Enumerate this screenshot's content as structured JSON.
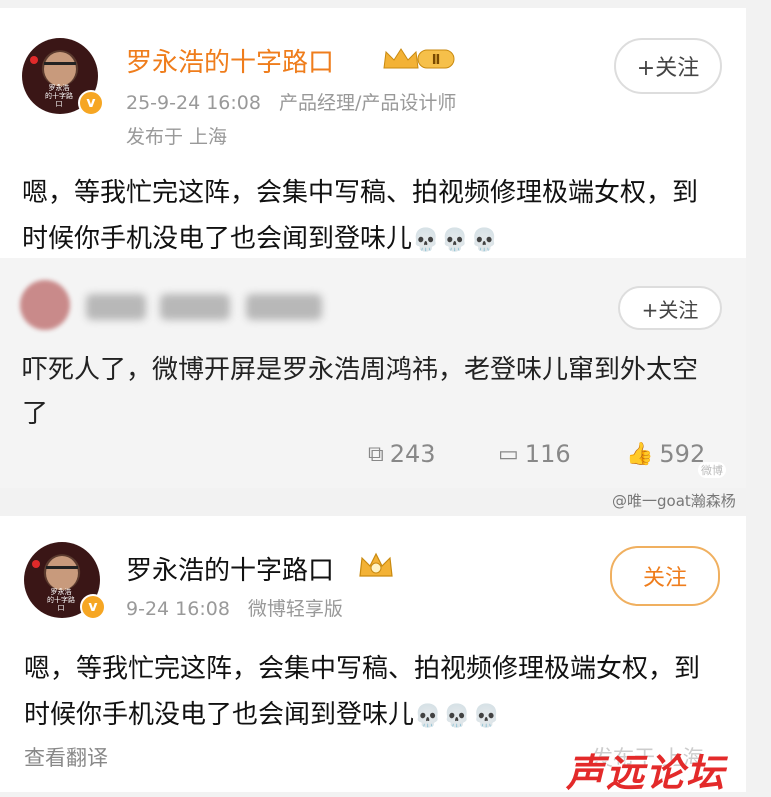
{
  "post1": {
    "username": "罗永浩的十字路口",
    "level_badge": "Ⅱ",
    "time": "25-9-24 16:08",
    "user_title": "产品经理/产品设计师",
    "location": "发布于 上海",
    "text": "嗯，等我忙完这阵，会集中写稿、拍视频修理极端女权，到时候你手机没电了也会闻到登味儿",
    "skulls": "💀💀💀",
    "follow_label": "+关注",
    "avatar_caption": "罗永浩 的十字路口"
  },
  "repost": {
    "text": "吓死人了，微博开屏是罗永浩周鸿祎，老登味儿窜到外太空了",
    "follow_label": "+关注",
    "reposts": "243",
    "comments": "116",
    "likes": "592"
  },
  "watermarks": {
    "author": "@唯一goat瀚森杨",
    "tiny": "微博"
  },
  "post2": {
    "username": "罗永浩的十字路口",
    "time": "9-24 16:08",
    "source": "微博轻享版",
    "text": "嗯，等我忙完这阵，会集中写稿、拍视频修理极端女权，到时候你手机没电了也会闻到登味儿",
    "skulls": "💀💀💀",
    "follow_label": "关注",
    "translate": "查看翻译",
    "location_faded": "发布于 上海"
  },
  "site_logo": "声远论坛",
  "colors": {
    "accent_orange": "#ef7d1c",
    "gold": "#f6a623",
    "logo_red": "#e32a2a"
  }
}
